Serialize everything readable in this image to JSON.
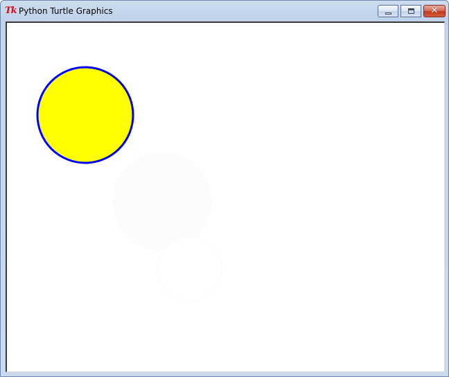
{
  "window": {
    "title": "Python Turtle Graphics",
    "app_icon": "tk-icon",
    "app_icon_text": "Tk",
    "buttons": {
      "minimize_icon": "minimize-icon",
      "maximize_icon": "maximize-icon",
      "close_icon": "close-icon",
      "close_glyph": "✕"
    }
  },
  "canvas": {
    "background": "#ffffff",
    "shapes": [
      {
        "type": "circle",
        "fill": "#ffff00",
        "outline": "#0000ff",
        "outline_width": 3
      },
      {
        "type": "circle",
        "fill": "#fcfcfc",
        "outline": "#fcfcfc",
        "outline_width": 1
      },
      {
        "type": "circle",
        "fill": "#ffffff",
        "outline": "#fafafa",
        "outline_width": 1
      }
    ]
  }
}
